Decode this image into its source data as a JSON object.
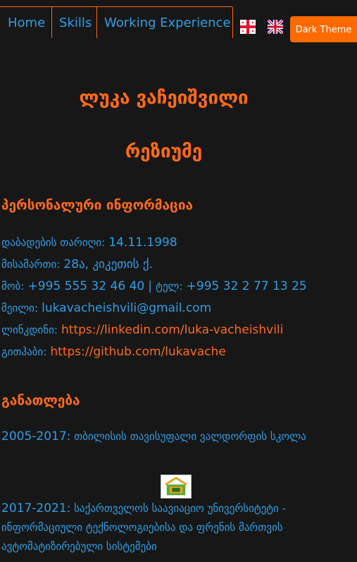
{
  "nav": {
    "items": [
      "Home",
      "Skills",
      "Working Experience"
    ],
    "theme_button": "Dark Theme",
    "languages": [
      {
        "icon": "georgia-flag-icon"
      },
      {
        "icon": "uk-flag-icon"
      }
    ]
  },
  "header": {
    "name": "ლუკა ვაჩეიშვილი",
    "subtitle": "რეზიუმე"
  },
  "personal": {
    "title": "პერსონალური ინფორმაცია",
    "dob_label": "დაბადების თარიღი:",
    "dob_value": "14.11.1998",
    "address_label": "მისამართი:",
    "address_value": "28ა, კიკეთის ქ.",
    "mobile_label": "მობ:",
    "mobile_value": "+995 555 32 46 40",
    "sep": "|",
    "phone_label": "ტელ:",
    "phone_value": "+995 32 2 77 13 25",
    "email_label": "მეილი:",
    "email_value": "lukavacheishvili@gmail.com",
    "linkedin_label": "ლინკდინი:",
    "linkedin_value": "https://linkedin.com/luka-vacheishvili",
    "github_label": "გითჰაბი:",
    "github_value": "https://github.com/lukavache"
  },
  "education": {
    "title": "განათლება",
    "items": [
      {
        "years": "2005-2017:",
        "text": "თბილისის თავისუფალი ვალდორფის სკოლა"
      },
      {
        "years": "2017-2021:",
        "text": "საქართველოს საავიაციო უნივერსიტეტი - ინფორმაციული ტექნოლოგიებისა და ფრენის მართვის ავტომატიზირებული სისტემები"
      }
    ]
  },
  "colors": {
    "accent": "#ff6a1a",
    "link": "#2f9fe6",
    "background": "#171717"
  }
}
